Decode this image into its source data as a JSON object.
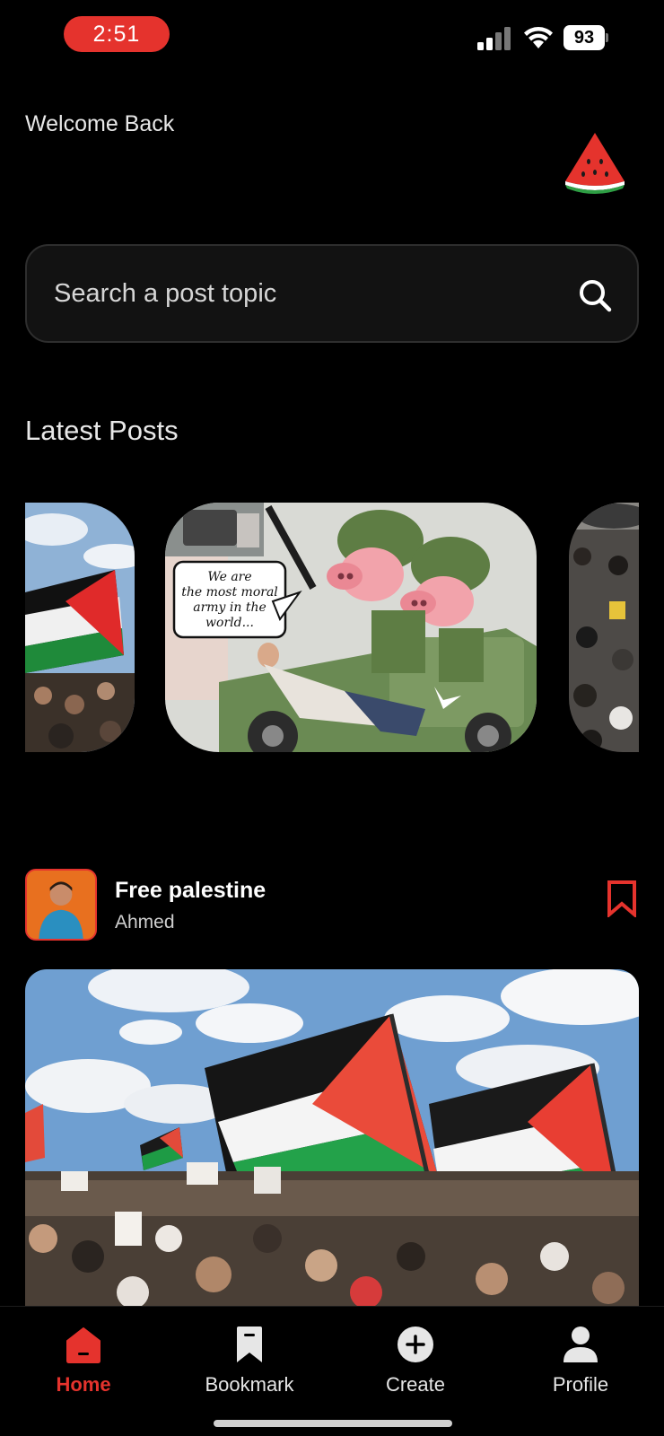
{
  "status_bar": {
    "time": "2:51",
    "battery": "93"
  },
  "header": {
    "welcome": "Welcome Back",
    "logo_icon": "watermelon-icon"
  },
  "search": {
    "placeholder": "Search a post topic",
    "value": ""
  },
  "latest_posts": {
    "title": "Latest Posts"
  },
  "post": {
    "title": "Free palestine",
    "author": "Ahmed",
    "bookmark_icon": "bookmark-icon"
  },
  "nav": {
    "items": [
      {
        "label": "Home",
        "icon": "home-icon",
        "active": true
      },
      {
        "label": "Bookmark",
        "icon": "bookmark-icon",
        "active": false
      },
      {
        "label": "Create",
        "icon": "plus-circle-icon",
        "active": false
      },
      {
        "label": "Profile",
        "icon": "user-icon",
        "active": false
      }
    ]
  },
  "colors": {
    "accent": "#e5332d",
    "background": "#000000",
    "search_bg": "#121212"
  }
}
